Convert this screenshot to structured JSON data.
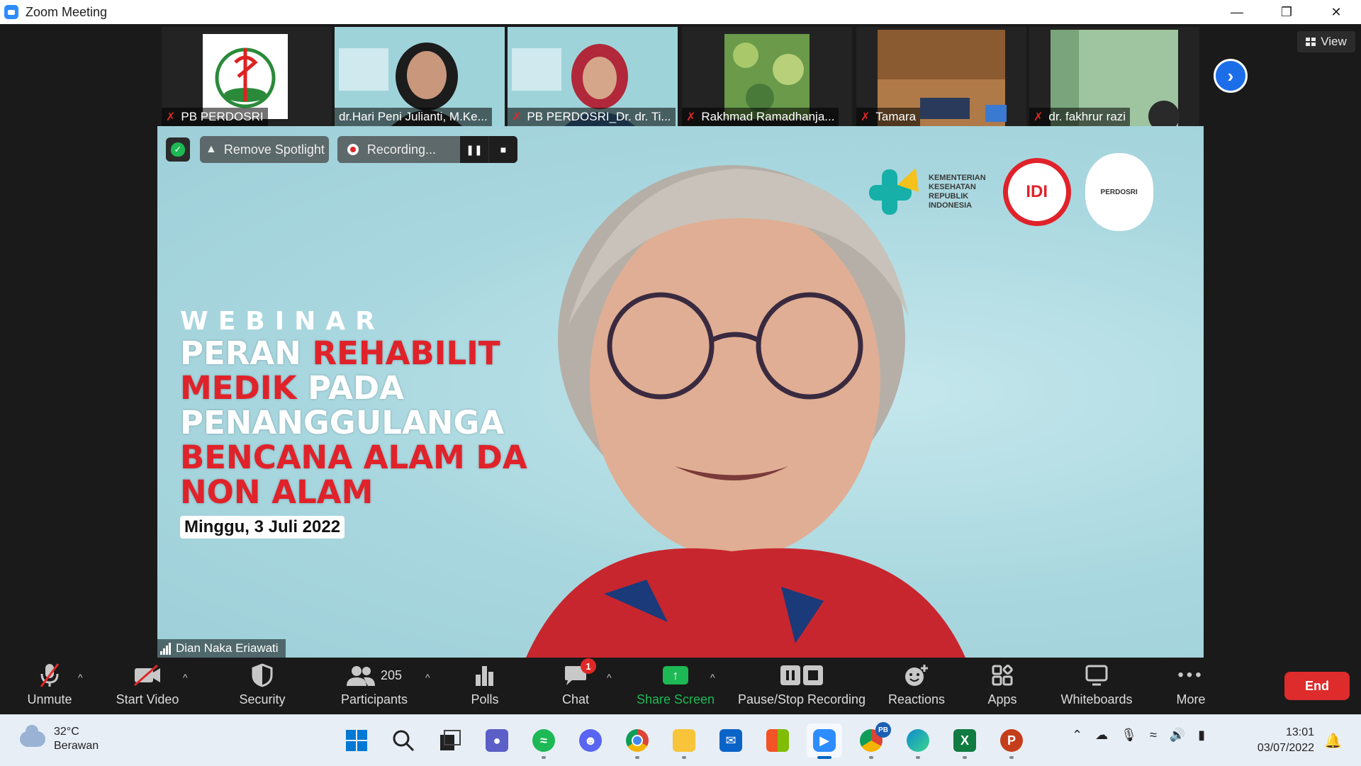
{
  "window": {
    "title": "Zoom Meeting"
  },
  "thumbnails": [
    {
      "name": "PB PERDOSRI"
    },
    {
      "name": "dr.Hari Peni Julianti, M.Ke..."
    },
    {
      "name": "PB PERDOSRI_Dr. dr. Ti..."
    },
    {
      "name": "Rakhmad Ramadhanja..."
    },
    {
      "name": "Tamara"
    },
    {
      "name": "dr. fakhrur razi"
    }
  ],
  "view_label": "View",
  "spotlight": {
    "remove_label": "Remove Spotlight",
    "recording_label": "Recording..."
  },
  "main_video": {
    "speaker": "Dian Naka Eriawati",
    "slide": {
      "kicker": "WEBINAR",
      "line1_white": "PERAN ",
      "line1_red": "REHABILIT",
      "line2_red": "MEDIK",
      "line2_white": " PADA",
      "line3": "PENANGGULANGA",
      "line4": "BENCANA ALAM DA",
      "line5": "NON ALAM",
      "date": "Minggu, 3 Juli 2022",
      "ministry": [
        "KEMENTERIAN",
        "KESEHATAN",
        "REPUBLIK",
        "INDONESIA"
      ],
      "idi": "IDI",
      "perdosri": "PERDOSRI"
    }
  },
  "toolbar": {
    "unmute": "Unmute",
    "start_video": "Start Video",
    "security": "Security",
    "participants": "Participants",
    "participants_count": "205",
    "polls": "Polls",
    "chat": "Chat",
    "chat_badge": "1",
    "share_screen": "Share Screen",
    "pause_stop": "Pause/Stop Recording",
    "reactions": "Reactions",
    "apps": "Apps",
    "whiteboards": "Whiteboards",
    "more": "More",
    "end": "End"
  },
  "taskbar": {
    "temperature": "32°C",
    "weather": "Berawan",
    "time": "13:01",
    "date": "03/07/2022",
    "chrome_badge": "PB"
  },
  "colors": {
    "zoom_blue": "#2d8cff",
    "end_red": "#de2b2b",
    "share_green": "#1db954",
    "slide_red": "#e0222a"
  }
}
